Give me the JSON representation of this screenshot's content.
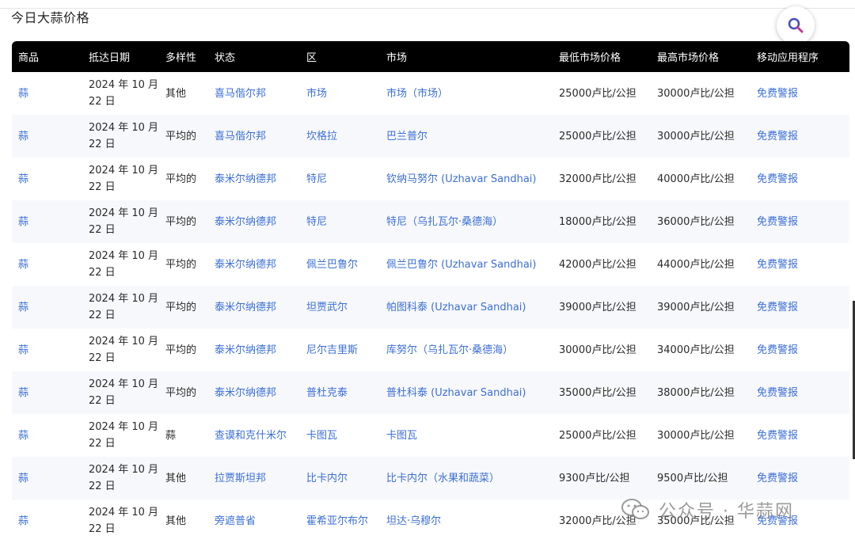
{
  "page": {
    "title": "今日大蒜价格"
  },
  "search": {
    "icon": "search-icon"
  },
  "table": {
    "headers": [
      "商品",
      "抵达日期",
      "多样性",
      "状态",
      "区",
      "市场",
      "最低市场价格",
      "最高市场价格",
      "移动应用程序"
    ],
    "rows": [
      {
        "commodity": "蒜",
        "date": "2024 年 10 月 22 日",
        "variety": "其他",
        "state": "喜马偕尔邦",
        "district": "市场",
        "market": "市场（市场）",
        "min_price": "25000卢比/公担",
        "max_price": "30000卢比/公担",
        "app": "免费警报"
      },
      {
        "commodity": "蒜",
        "date": "2024 年 10 月 22 日",
        "variety": "平均的",
        "state": "喜马偕尔邦",
        "district": "坎格拉",
        "market": "巴兰普尔",
        "min_price": "25000卢比/公担",
        "max_price": "30000卢比/公担",
        "app": "免费警报"
      },
      {
        "commodity": "蒜",
        "date": "2024 年 10 月 22 日",
        "variety": "平均的",
        "state": "泰米尔纳德邦",
        "district": "特尼",
        "market": "钦纳马努尔 (Uzhavar Sandhai)",
        "min_price": "32000卢比/公担",
        "max_price": "40000卢比/公担",
        "app": "免费警报"
      },
      {
        "commodity": "蒜",
        "date": "2024 年 10 月 22 日",
        "variety": "平均的",
        "state": "泰米尔纳德邦",
        "district": "特尼",
        "market": "特尼（乌扎瓦尔·桑德海）",
        "min_price": "18000卢比/公担",
        "max_price": "36000卢比/公担",
        "app": "免费警报"
      },
      {
        "commodity": "蒜",
        "date": "2024 年 10 月 22 日",
        "variety": "平均的",
        "state": "泰米尔纳德邦",
        "district": "佩兰巴鲁尔",
        "market": "佩兰巴鲁尔 (Uzhavar Sandhai)",
        "min_price": "42000卢比/公担",
        "max_price": "44000卢比/公担",
        "app": "免费警报"
      },
      {
        "commodity": "蒜",
        "date": "2024 年 10 月 22 日",
        "variety": "平均的",
        "state": "泰米尔纳德邦",
        "district": "坦贾武尔",
        "market": "帕图科泰 (Uzhavar Sandhai)",
        "min_price": "39000卢比/公担",
        "max_price": "39000卢比/公担",
        "app": "免费警报"
      },
      {
        "commodity": "蒜",
        "date": "2024 年 10 月 22 日",
        "variety": "平均的",
        "state": "泰米尔纳德邦",
        "district": "尼尔吉里斯",
        "market": "库努尔（乌扎瓦尔·桑德海）",
        "min_price": "30000卢比/公担",
        "max_price": "34000卢比/公担",
        "app": "免费警报"
      },
      {
        "commodity": "蒜",
        "date": "2024 年 10 月 22 日",
        "variety": "平均的",
        "state": "泰米尔纳德邦",
        "district": "普杜克泰",
        "market": "普杜科泰 (Uzhavar Sandhai)",
        "min_price": "35000卢比/公担",
        "max_price": "38000卢比/公担",
        "app": "免费警报"
      },
      {
        "commodity": "蒜",
        "date": "2024 年 10 月 22 日",
        "variety": "蒜",
        "state": "查谟和克什米尔",
        "district": "卡图瓦",
        "market": "卡图瓦",
        "min_price": "25000卢比/公担",
        "max_price": "30000卢比/公担",
        "app": "免费警报"
      },
      {
        "commodity": "蒜",
        "date": "2024 年 10 月 22 日",
        "variety": "其他",
        "state": "拉贾斯坦邦",
        "district": "比卡内尔",
        "market": "比卡内尔（水果和蔬菜）",
        "min_price": "9300卢比/公担",
        "max_price": "9500卢比/公担",
        "app": "免费警报"
      },
      {
        "commodity": "蒜",
        "date": "2024 年 10 月 22 日",
        "variety": "其他",
        "state": "旁遮普省",
        "district": "霍希亚尔布尔",
        "market": "坦达·乌穆尔",
        "min_price": "32000卢比/公担",
        "max_price": "35000卢比/公担",
        "app": "免费警报"
      }
    ]
  },
  "watermark": {
    "icon": "wechat-icon",
    "text": "公众号 · 华蒜网"
  }
}
